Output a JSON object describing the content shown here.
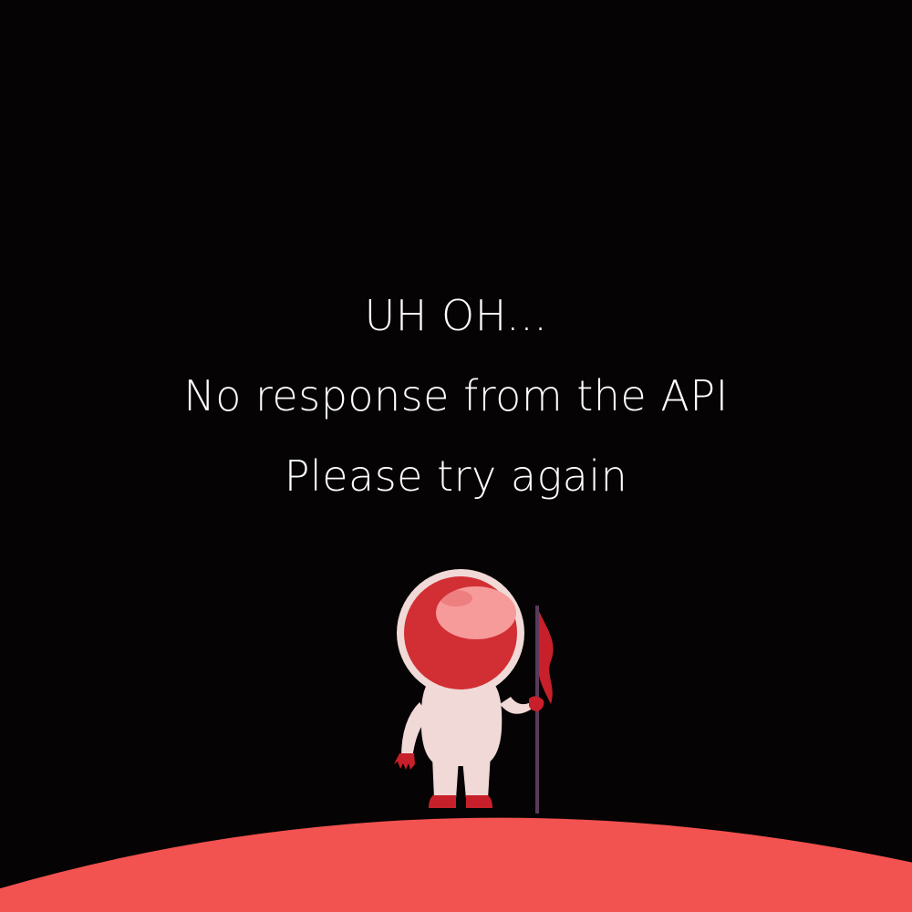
{
  "message": {
    "line1": "UH OH...",
    "line2": "No response from the API",
    "line3": "Please try again"
  },
  "illustration": {
    "figure": "astronaut-with-flag",
    "planet_color": "#f25250",
    "helmet_color": "#d12f33",
    "visor_highlight_color": "#f79a9a",
    "suit_color": "#f0d9d7",
    "pole_color": "#5a3a5a",
    "flag_color": "#c8202a",
    "background_color": "#050303"
  }
}
